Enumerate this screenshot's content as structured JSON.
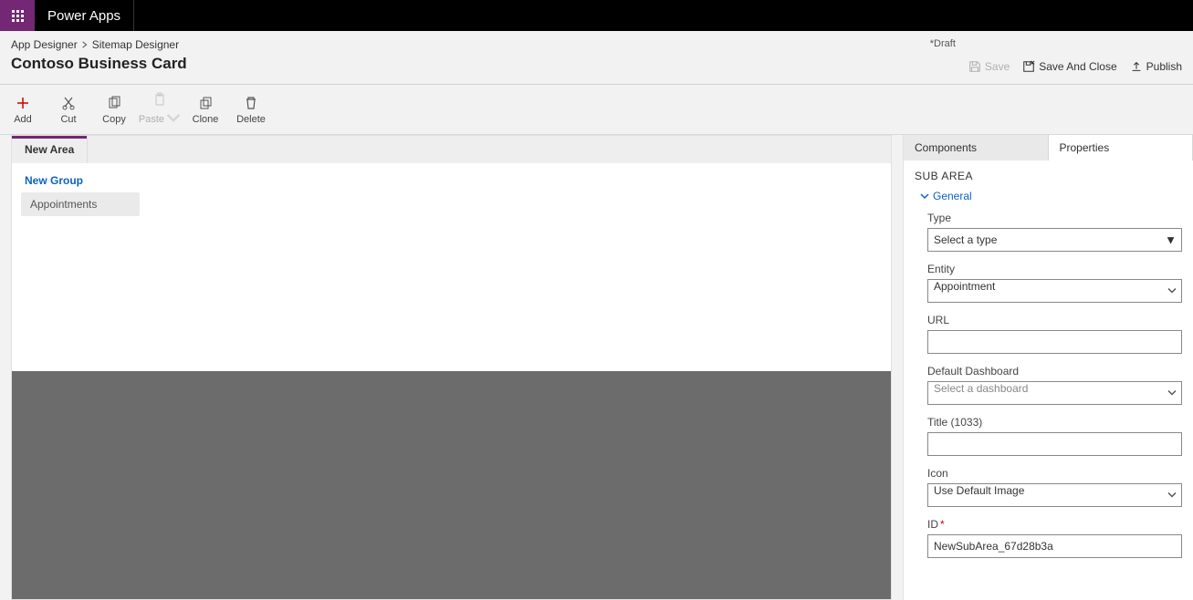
{
  "app_name": "Power Apps",
  "breadcrumbs": {
    "root": "App Designer",
    "current": "Sitemap Designer"
  },
  "page_title": "Contoso Business Card",
  "status": "*Draft",
  "header_actions": {
    "save": "Save",
    "save_close": "Save And Close",
    "publish": "Publish"
  },
  "toolbar": {
    "add": "Add",
    "cut": "Cut",
    "copy": "Copy",
    "paste": "Paste",
    "clone": "Clone",
    "delete": "Delete"
  },
  "canvas": {
    "area_tab": "New Area",
    "group_label": "New Group",
    "subarea_label": "Appointments"
  },
  "panel": {
    "tabs": {
      "components": "Components",
      "properties": "Properties"
    },
    "section_title": "SUB AREA",
    "general": "General",
    "fields": {
      "type": {
        "label": "Type",
        "placeholder": "Select a type"
      },
      "entity": {
        "label": "Entity",
        "value": "Appointment"
      },
      "url": {
        "label": "URL",
        "value": ""
      },
      "dashboard": {
        "label": "Default Dashboard",
        "placeholder": "Select a dashboard"
      },
      "title": {
        "label": "Title (1033)",
        "value": ""
      },
      "icon": {
        "label": "Icon",
        "value": "Use Default Image"
      },
      "id": {
        "label": "ID",
        "value": "NewSubArea_67d28b3a"
      }
    }
  }
}
